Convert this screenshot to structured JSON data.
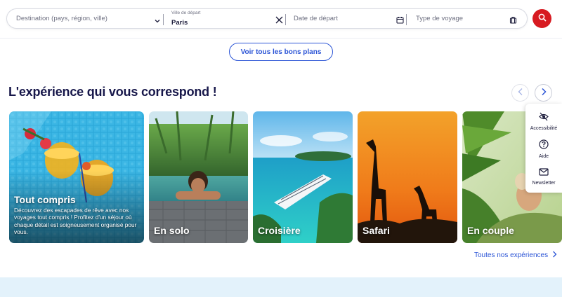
{
  "search": {
    "destination_placeholder": "Destination (pays, région, ville)",
    "departure_city_label": "Ville de départ",
    "departure_city_value": "Paris",
    "date_placeholder": "Date de départ",
    "trip_type_placeholder": "Type de voyage"
  },
  "deals_button": "Voir tous les bons plans",
  "section": {
    "title": "L'expérience qui vous correspond !",
    "see_all": "Toutes nos expériences"
  },
  "cards": [
    {
      "title": "Tout compris",
      "description": "Découvrez des escapades de rêve avec nos voyages tout compris ! Profitez d'un séjour où chaque détail est soigneusement organisé pour vous."
    },
    {
      "title": "En solo"
    },
    {
      "title": "Croisière"
    },
    {
      "title": "Safari"
    },
    {
      "title": "En couple"
    }
  ],
  "side_tools": [
    {
      "label": "Accessibilité",
      "icon": "eye-slash-icon"
    },
    {
      "label": "Aide",
      "icon": "question-circle-icon"
    },
    {
      "label": "Newsletter",
      "icon": "envelope-icon"
    }
  ],
  "colors": {
    "accent_blue": "#2c55d6",
    "search_red": "#d71a21",
    "title_navy": "#17174a",
    "bottom_band": "#e3f2fb"
  }
}
